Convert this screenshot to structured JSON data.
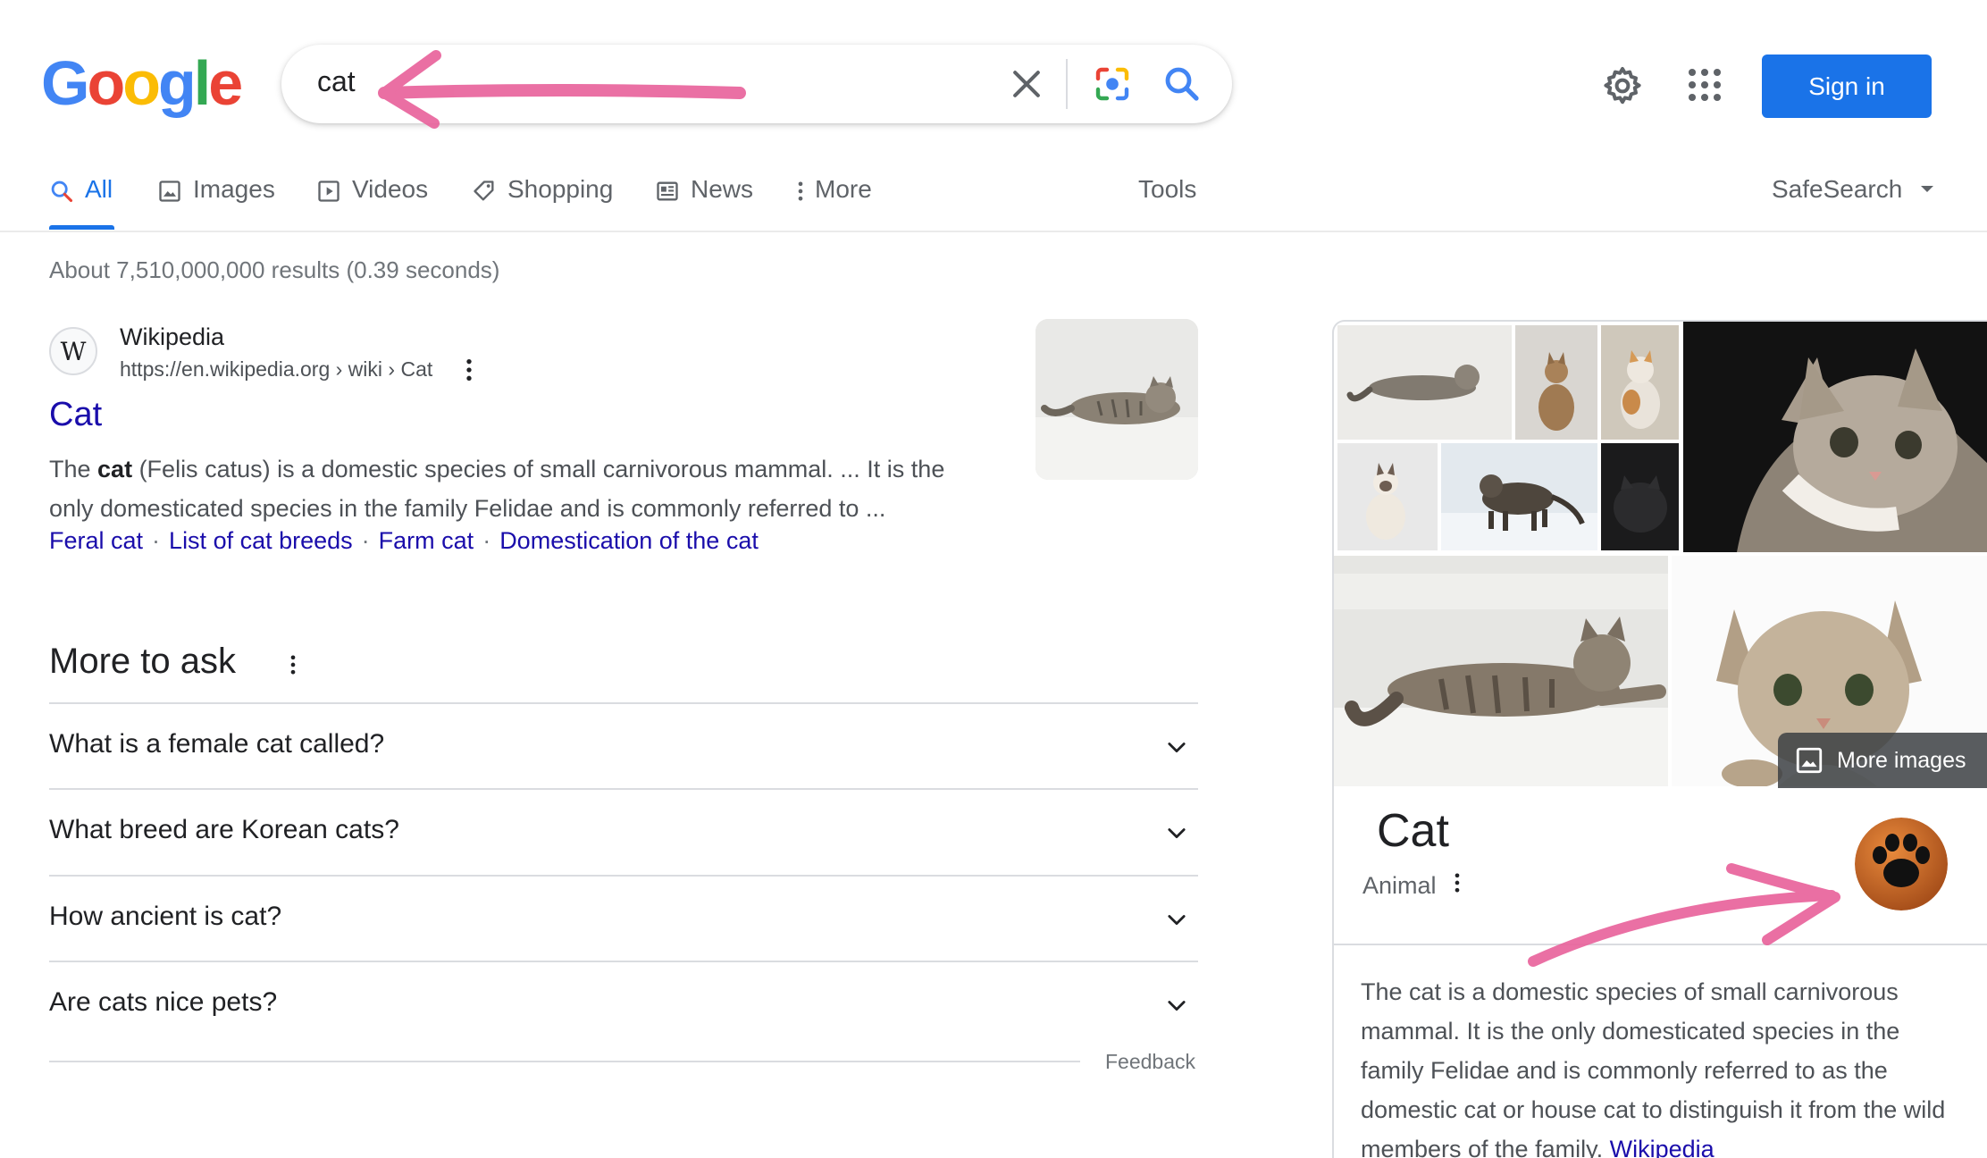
{
  "header": {
    "logo_text": "Google",
    "search_query": "cat",
    "sign_in_label": "Sign in"
  },
  "tabs": [
    {
      "label": "All",
      "icon": "search-icon",
      "active": true
    },
    {
      "label": "Images",
      "icon": "image-icon"
    },
    {
      "label": "Videos",
      "icon": "play-icon"
    },
    {
      "label": "Shopping",
      "icon": "tag-icon"
    },
    {
      "label": "News",
      "icon": "newspaper-icon"
    },
    {
      "label": "More",
      "icon": "kebab-icon"
    }
  ],
  "tools_label": "Tools",
  "safesearch_label": "SafeSearch",
  "stats": "About 7,510,000,000 results (0.39 seconds)",
  "result": {
    "favicon_letter": "W",
    "site_name": "Wikipedia",
    "url": "https://en.wikipedia.org › wiki › Cat",
    "title": "Cat",
    "snippet_before": "The ",
    "snippet_bold": "cat",
    "snippet_after": " (Felis catus) is a domestic species of small carnivorous mammal. ... It is the only domesticated species in the family Felidae and is commonly referred to ...",
    "sitelinks": [
      "Feral cat",
      "List of cat breeds",
      "Farm cat",
      "Domestication of the cat"
    ]
  },
  "more_to_ask": {
    "title": "More to ask",
    "questions": [
      "What is a female cat called?",
      "What breed are Korean cats?",
      "How ancient is cat?",
      "Are cats nice pets?"
    ],
    "feedback_label": "Feedback"
  },
  "knowledge_panel": {
    "more_images_label": "More images",
    "title": "Cat",
    "subtitle": "Animal",
    "description": "The cat is a domestic species of small carnivorous mammal. It is the only domesticated species in the family Felidae and is commonly referred to as the domestic cat or house cat to distinguish it from the wild members of the family. ",
    "source_link": "Wikipedia"
  },
  "colors": {
    "accent": "#1a73e8",
    "link": "#1a0dab",
    "annotation": "#e8609a",
    "paw_badge": "#c8621e"
  }
}
